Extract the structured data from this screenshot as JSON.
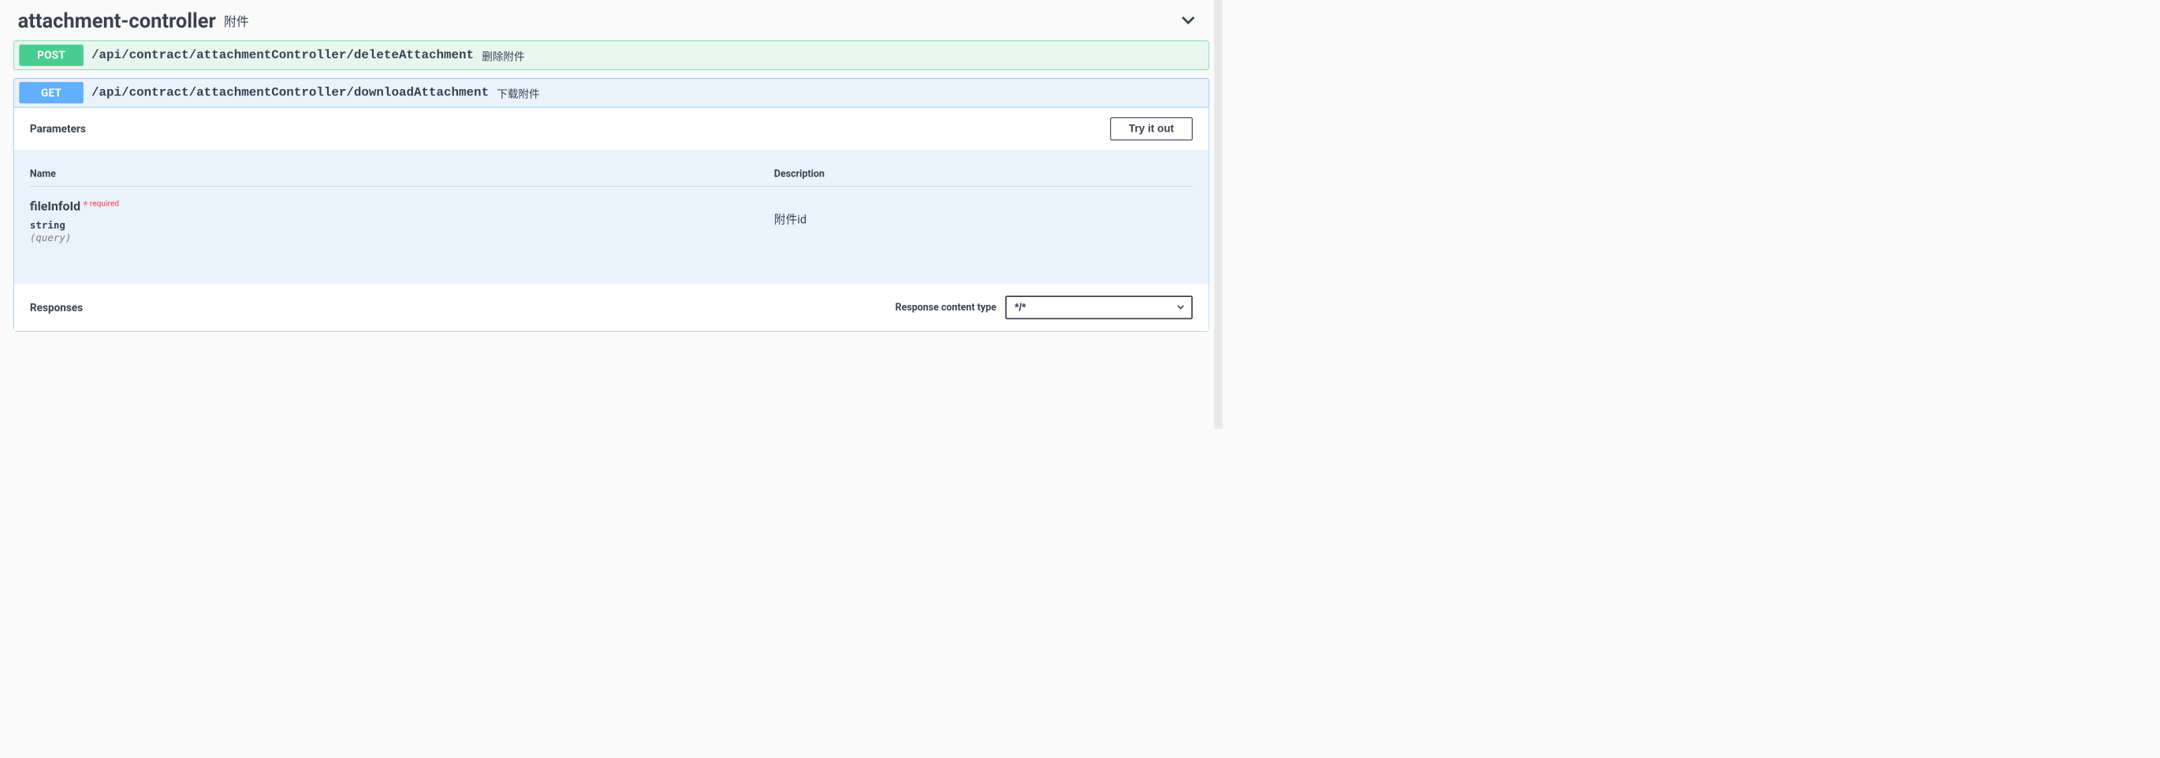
{
  "section": {
    "name": "attachment-controller",
    "name_sub": "附件"
  },
  "ops": {
    "post": {
      "method": "POST",
      "path": "/api/contract/attachmentController/deleteAttachment",
      "summary": "删除附件"
    },
    "get": {
      "method": "GET",
      "path": "/api/contract/attachmentController/downloadAttachment",
      "summary": "下载附件"
    }
  },
  "parameters": {
    "header": "Parameters",
    "col_name": "Name",
    "col_desc": "Description",
    "tryout": "Try it out",
    "items": [
      {
        "name": "fileInfoId",
        "required_label": "required",
        "type": "string",
        "in": "(query)",
        "description": "附件id"
      }
    ]
  },
  "responses": {
    "header": "Responses",
    "content_type_label": "Response content type",
    "content_type_value": "*/*"
  }
}
